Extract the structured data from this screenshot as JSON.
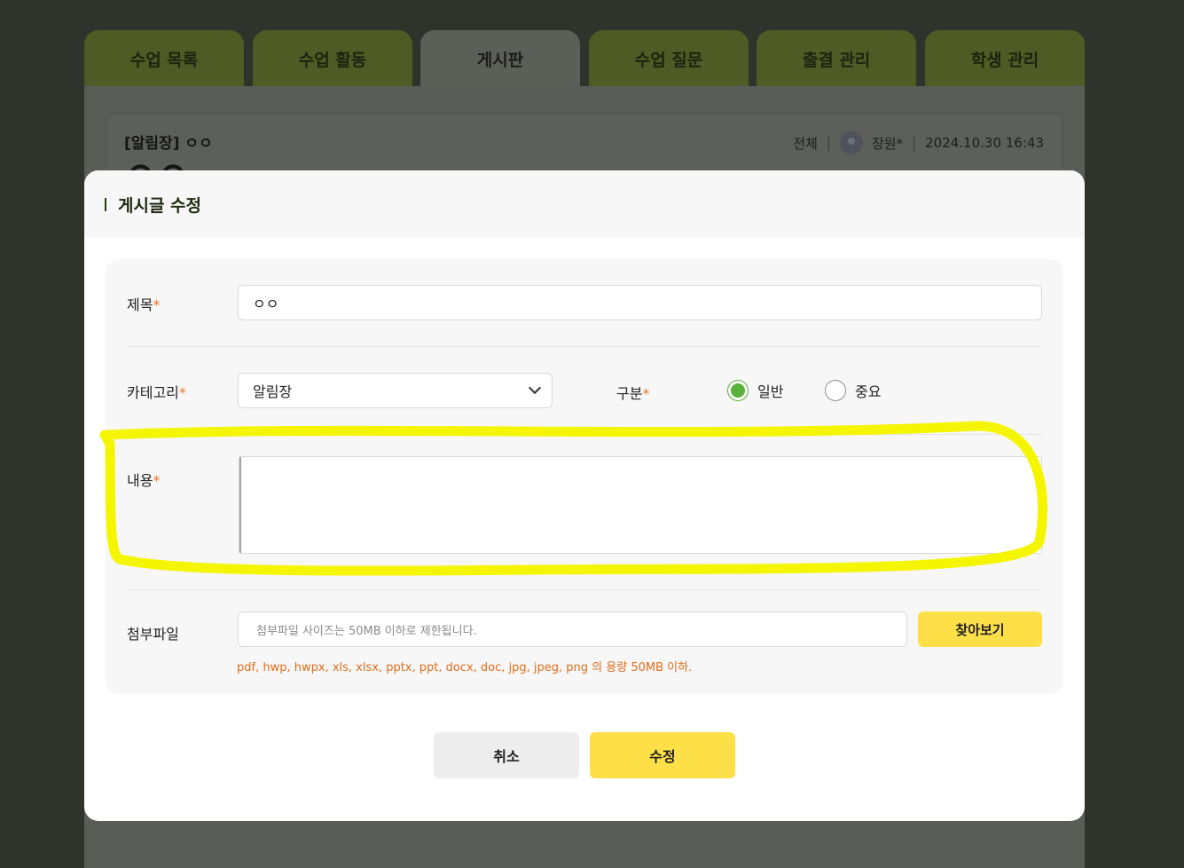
{
  "tabs": [
    {
      "label": "수업 목록",
      "active": false
    },
    {
      "label": "수업 활동",
      "active": false
    },
    {
      "label": "게시판",
      "active": true
    },
    {
      "label": "수업 질문",
      "active": false
    },
    {
      "label": "출결 관리",
      "active": false
    },
    {
      "label": "학생 관리",
      "active": false
    }
  ],
  "background_post": {
    "title": "[알림장] ㅇㅇ",
    "scope": "전체",
    "author": "장원*",
    "date": "2024.10.30 16:43",
    "heading": "ㅇㅇ"
  },
  "modal": {
    "title": "게시글 수정",
    "required_mark": "*",
    "fields": {
      "title_label": "제목",
      "title_value": "ㅇㅇ",
      "category_label": "카테고리",
      "category_value": "알림장",
      "type_label": "구분",
      "type_options": [
        {
          "label": "일반",
          "checked": true
        },
        {
          "label": "중요",
          "checked": false
        }
      ],
      "content_label": "내용",
      "content_value": "",
      "attachment_label": "첨부파일",
      "attachment_placeholder": "첨부파일 사이즈는 50MB 이하로 제한됩니다.",
      "browse_label": "찾아보기",
      "attachment_hint": "pdf, hwp, hwpx, xls, xlsx, pptx, ppt, docx, doc, jpg, jpeg, png 의 용량 50MB 이하."
    },
    "buttons": {
      "cancel": "취소",
      "submit": "수정"
    }
  },
  "colors": {
    "accent_yellow": "#fde047",
    "radio_green": "#5bb23a",
    "required_orange": "#e8782a",
    "highlight_marker": "#f5f500"
  }
}
